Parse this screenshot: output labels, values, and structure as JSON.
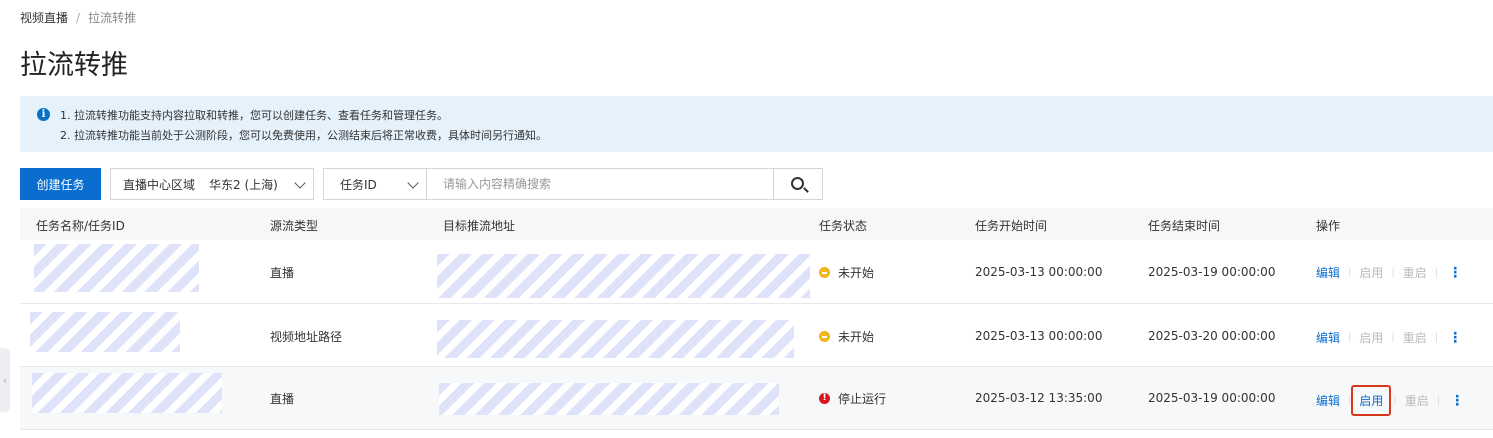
{
  "breadcrumb": {
    "parent": "视频直播",
    "separator": "/",
    "current": "拉流转推"
  },
  "page_title": "拉流转推",
  "notice": {
    "line1": "1. 拉流转推功能支持内容拉取和转推，您可以创建任务、查看任务和管理任务。",
    "line2": "2. 拉流转推功能当前处于公测阶段，您可以免费使用，公测结束后将正常收费，具体时间另行通知。"
  },
  "toolbar": {
    "create_label": "创建任务",
    "region_label": "直播中心区域",
    "region_value": "华东2 (上海)",
    "field_value": "任务ID",
    "search_placeholder": "请输入内容精确搜索"
  },
  "table": {
    "columns": [
      "任务名称/任务ID",
      "源流类型",
      "目标推流地址",
      "任务状态",
      "任务开始时间",
      "任务结束时间",
      "操作"
    ],
    "rows": [
      {
        "source_type": "直播",
        "status": "未开始",
        "start": "2025-03-13 00:00:00",
        "end": "2025-03-19 00:00:00",
        "ops": [
          "编辑",
          "启用",
          "重启"
        ]
      },
      {
        "source_type": "视频地址路径",
        "status": "未开始",
        "start": "2025-03-13 00:00:00",
        "end": "2025-03-20 00:00:00",
        "ops": [
          "编辑",
          "启用",
          "重启"
        ]
      },
      {
        "source_type": "直播",
        "status": "停止运行",
        "start": "2025-03-12 13:35:00",
        "end": "2025-03-19 00:00:00",
        "ops": [
          "编辑",
          "启用",
          "重启"
        ]
      }
    ]
  },
  "icons": {
    "info": "info-icon",
    "search": "search-icon",
    "more": "more-vertical-icon",
    "collapse": "chevron-left-icon"
  },
  "colors": {
    "primary": "#0a6ed1",
    "pending": "#f2b61a",
    "stopped": "#d9161c",
    "highlight": "#d9371b"
  }
}
